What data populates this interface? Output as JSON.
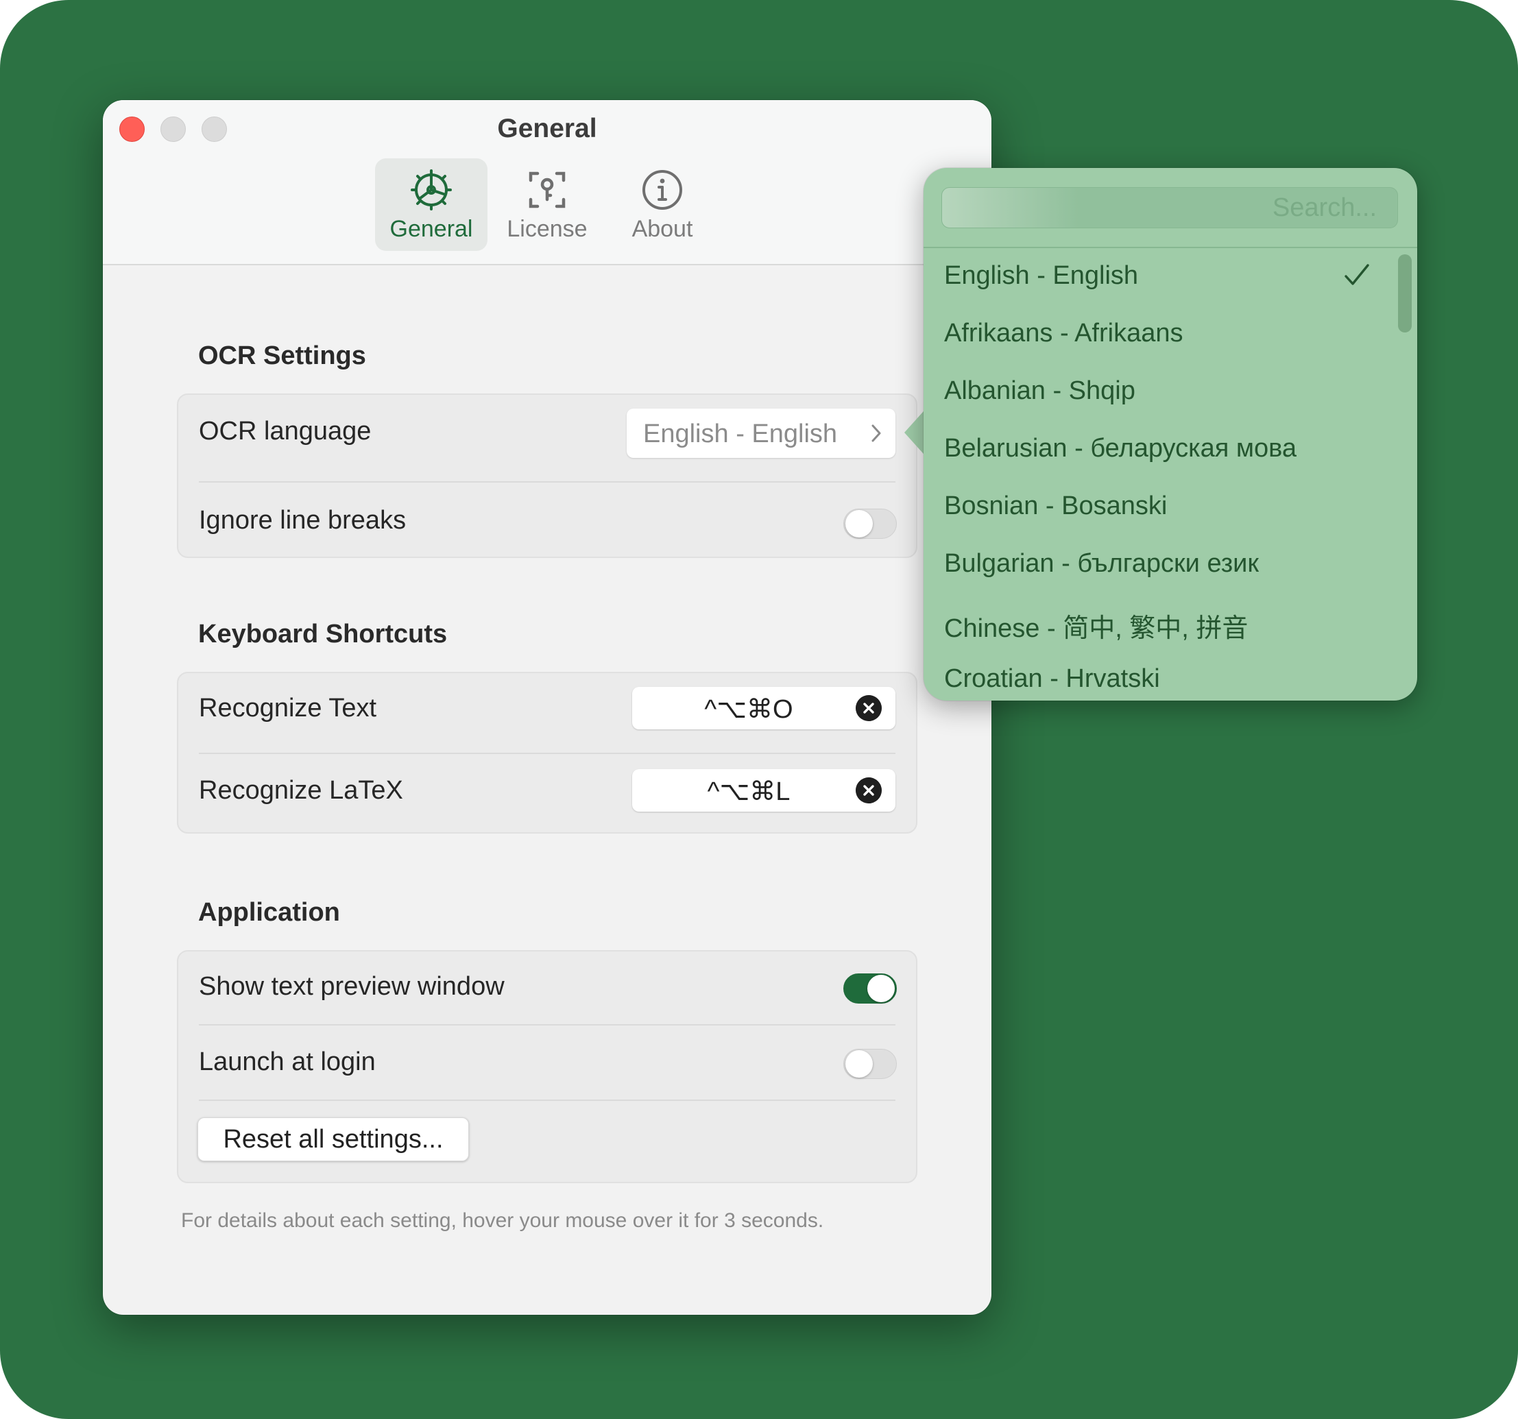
{
  "window": {
    "title": "General",
    "tabs": [
      {
        "label": "General",
        "icon": "gear-icon",
        "active": true
      },
      {
        "label": "License",
        "icon": "key-icon",
        "active": false
      },
      {
        "label": "About",
        "icon": "info-icon",
        "active": false
      }
    ]
  },
  "ocr": {
    "title": "OCR Settings",
    "language_label": "OCR language",
    "language_value": "English - English",
    "ignore_label": "Ignore line breaks",
    "ignore_on": false
  },
  "shortcuts": {
    "title": "Keyboard Shortcuts",
    "items": [
      {
        "label": "Recognize Text",
        "keys": "^⌥⌘O"
      },
      {
        "label": "Recognize LaTeX",
        "keys": "^⌥⌘L"
      }
    ]
  },
  "application": {
    "title": "Application",
    "preview_label": "Show text preview window",
    "preview_on": true,
    "launch_label": "Launch at login",
    "launch_on": false,
    "reset_label": "Reset all settings..."
  },
  "footer": "For details about each setting, hover your mouse over it for 3 seconds.",
  "language_popover": {
    "search_placeholder": "Search...",
    "selected": "English - English",
    "languages": [
      "English - English",
      "Afrikaans - Afrikaans",
      "Albanian - Shqip",
      "Belarusian - беларуская мова",
      "Bosnian - Bosanski",
      "Bulgarian - български език",
      "Chinese - 简中, 繁中, 拼音",
      "Croatian - Hrvatski"
    ]
  },
  "colors": {
    "background": "#2c7243",
    "accent": "#1f6b3b",
    "popover": "#9fcca8",
    "close": "#ff5f57"
  }
}
